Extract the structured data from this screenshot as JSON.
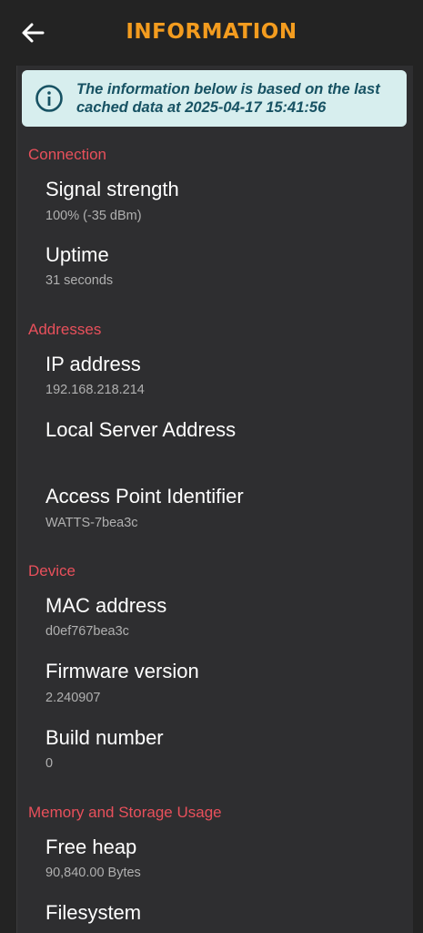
{
  "header": {
    "title": "INFORMATION",
    "back_icon": "arrow-left-icon"
  },
  "banner": {
    "icon": "info-icon",
    "text": "The information below is based on the last cached data at 2025-04-17 15:41:56",
    "background": "#d7eeee",
    "text_color": "#175263"
  },
  "colors": {
    "accent": "#f39c1f",
    "section_header": "#e8505b",
    "background": "#232323"
  },
  "sections": {
    "connection": {
      "title": "Connection",
      "signal_strength": {
        "label": "Signal strength",
        "value": "100% (-35 dBm)"
      },
      "uptime": {
        "label": "Uptime",
        "value": "31 seconds"
      }
    },
    "addresses": {
      "title": "Addresses",
      "ip_address": {
        "label": "IP address",
        "value": "192.168.218.214"
      },
      "local_server_address": {
        "label": "Local Server Address",
        "value": ""
      },
      "access_point_identifier": {
        "label": "Access Point Identifier",
        "value": "WATTS-7bea3c"
      }
    },
    "device": {
      "title": "Device",
      "mac_address": {
        "label": "MAC address",
        "value": "d0ef767bea3c"
      },
      "firmware_version": {
        "label": "Firmware version",
        "value": "2.240907"
      },
      "build_number": {
        "label": "Build number",
        "value": "0"
      }
    },
    "memory": {
      "title": "Memory and Storage Usage",
      "free_heap": {
        "label": "Free heap",
        "value": "90,840.00 Bytes"
      },
      "filesystem": {
        "label": "Filesystem"
      }
    }
  }
}
